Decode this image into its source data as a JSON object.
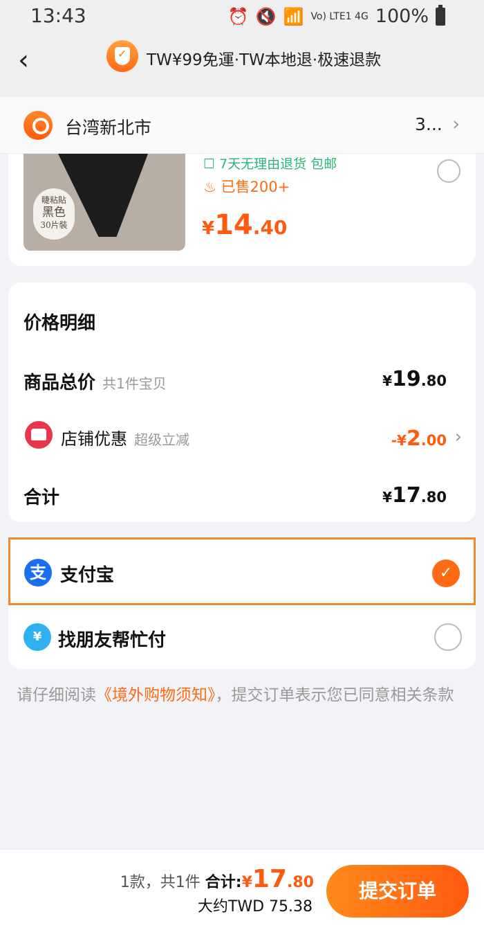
{
  "status": {
    "time": "13:43",
    "network": "Vo) LTE1 4G",
    "battery": "100%"
  },
  "header": {
    "back_icon": "chevron-left-icon",
    "badge_icon": "shield-check-icon",
    "title": "TW¥99免運·TW本地退·极速退款"
  },
  "address": {
    "icon": "location-pin-icon",
    "text": "台湾新北市",
    "right_text": "3..."
  },
  "product": {
    "image_badge_line1": "睫粘貼",
    "image_badge_line2": "黑色",
    "image_badge_line3": "30片裝",
    "promo_text": "7天无理由退货 包邮",
    "sold_text": "已售200+",
    "price_symbol": "¥",
    "price_int": "14",
    "price_dec": ".40"
  },
  "price_details": {
    "title": "价格明细",
    "subtotal_label": "商品总价",
    "subtotal_sub": "共1件宝贝",
    "subtotal_symbol": "¥",
    "subtotal_int": "19",
    "subtotal_dec": ".80",
    "store_label": "店铺优惠",
    "store_sub": "超级立减",
    "store_symbol": "-¥",
    "store_int": "2",
    "store_dec": ".00",
    "total_label": "合计",
    "total_symbol": "¥",
    "total_int": "17",
    "total_dec": ".80"
  },
  "payment": {
    "alipay_label": "支付宝",
    "alipay_icon_char": "支",
    "friend_label": "找朋友帮忙付",
    "friend_icon_char": "¥",
    "selected": "alipay"
  },
  "notice": {
    "prefix": "请仔细阅读",
    "link": "《境外购物须知》",
    "suffix": "，提交订单表示您已同意相关条款"
  },
  "footer": {
    "count_text": "1款，共1件",
    "total_label": "合计:",
    "total_symbol": "¥",
    "total_int": "17",
    "total_dec": ".80",
    "twd_text": "大约TWD 75.38",
    "submit_label": "提交订单"
  },
  "colors": {
    "accent": "#ff5a10",
    "selection_border": "#f08a2c",
    "alipay_blue": "#1a6ff0",
    "promo_green": "#2bb673"
  }
}
